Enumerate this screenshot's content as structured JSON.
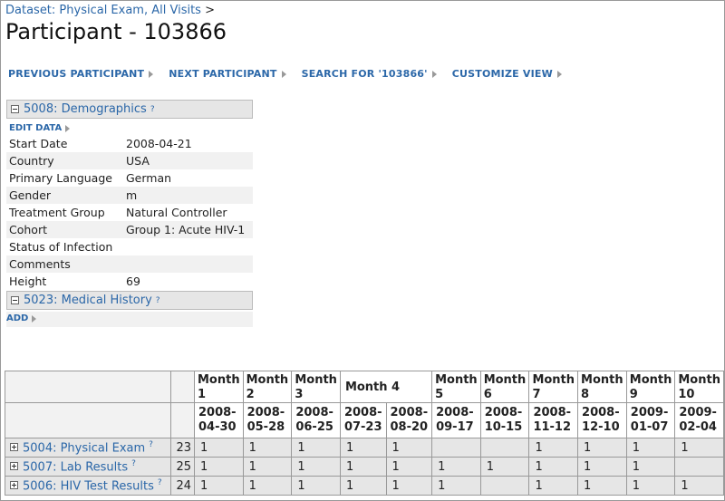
{
  "breadcrumb": {
    "link": "Dataset: Physical Exam, All Visits",
    "sep": " >"
  },
  "page_title": "Participant - 103866",
  "nav": {
    "previous": "PREVIOUS PARTICIPANT",
    "next": "NEXT PARTICIPANT",
    "search": "SEARCH FOR '103866'",
    "customize": "CUSTOMIZE VIEW"
  },
  "demographics": {
    "title": "5008: Demographics",
    "help": "?",
    "action": "EDIT DATA",
    "fields": [
      {
        "label": "Start Date",
        "value": "2008-04-21"
      },
      {
        "label": "Country",
        "value": "USA"
      },
      {
        "label": "Primary Language",
        "value": "German"
      },
      {
        "label": "Gender",
        "value": "m"
      },
      {
        "label": "Treatment Group",
        "value": "Natural Controller"
      },
      {
        "label": "Cohort",
        "value": "Group 1: Acute HIV-1"
      },
      {
        "label": "Status of Infection",
        "value": ""
      },
      {
        "label": "Comments",
        "value": ""
      },
      {
        "label": "Height",
        "value": "69"
      }
    ]
  },
  "medical_history": {
    "title": "5023: Medical History",
    "help": "?",
    "action": "ADD"
  },
  "grid": {
    "months": [
      {
        "label": "Month\n1"
      },
      {
        "label": "Month\n2"
      },
      {
        "label": "Month\n3"
      },
      {
        "label": "Month 4"
      },
      {
        "label": "Month\n5"
      },
      {
        "label": "Month\n6"
      },
      {
        "label": "Month\n7"
      },
      {
        "label": "Month\n8"
      },
      {
        "label": "Month\n9"
      },
      {
        "label": "Month\n10"
      }
    ],
    "dates": [
      "2008-\n04-30",
      "2008-\n05-28",
      "2008-\n06-25",
      "2008-\n07-23",
      "2008-\n08-20",
      "2008-\n09-17",
      "2008-\n10-15",
      "2008-\n11-12",
      "2008-\n12-10",
      "2009-\n01-07",
      "2009-\n02-04"
    ],
    "rows": [
      {
        "label": "5004: Physical Exam",
        "help": "?",
        "count": "23",
        "cells": [
          "1",
          "1",
          "1",
          "1",
          "1",
          "",
          "",
          "1",
          "1",
          "1",
          "1"
        ]
      },
      {
        "label": "5007: Lab Results",
        "help": "?",
        "count": "25",
        "cells": [
          "1",
          "1",
          "1",
          "1",
          "1",
          "1",
          "1",
          "1",
          "1",
          "1",
          ""
        ]
      },
      {
        "label": "5006: HIV Test Results",
        "help": "?",
        "count": "24",
        "cells": [
          "1",
          "1",
          "1",
          "1",
          "1",
          "1",
          "",
          "1",
          "1",
          "1",
          "1"
        ]
      }
    ]
  }
}
